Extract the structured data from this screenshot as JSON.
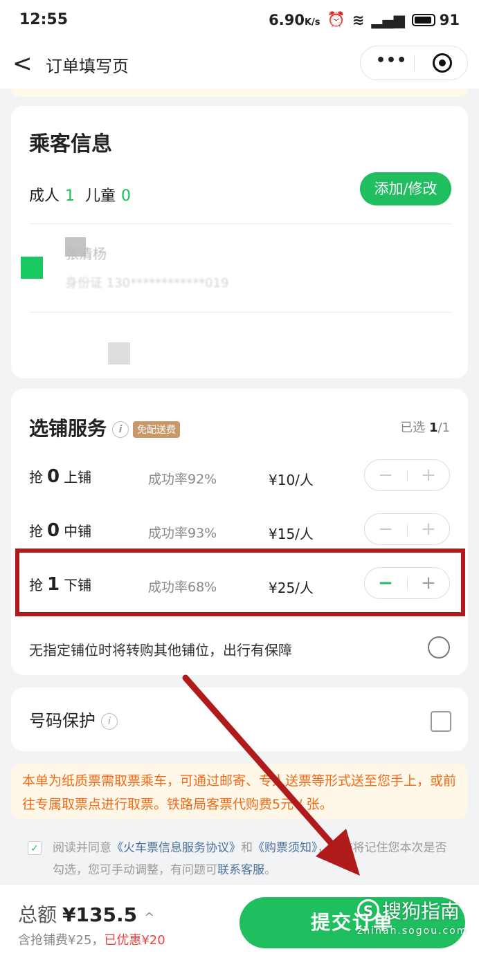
{
  "status_bar": {
    "time": "12:55",
    "speed": "6.90",
    "speed_unit": "K/s",
    "battery": "91"
  },
  "nav": {
    "back_icon": "<",
    "title": "订单填写页",
    "more_label": "•••"
  },
  "passenger": {
    "title": "乘客信息",
    "adult_label": "成人",
    "adult_count": "1",
    "child_label": "儿童",
    "child_count": "0",
    "add_button": "添加/修改",
    "name_blurred": "张清杨",
    "id_blurred": "身份证 130************019"
  },
  "berth": {
    "title": "选铺服务",
    "info_icon": "i",
    "free_badge": "免配送费",
    "selected_prefix": "已选 ",
    "selected_count": "1",
    "selected_total": "/1",
    "rows": [
      {
        "grab": "抢",
        "qty": "0",
        "berth": "上铺",
        "rate": "成功率92%",
        "price": "¥10/人",
        "minus": "−",
        "plus": "+"
      },
      {
        "grab": "抢",
        "qty": "0",
        "berth": "中铺",
        "rate": "成功率93%",
        "price": "¥15/人",
        "minus": "−",
        "plus": "+"
      },
      {
        "grab": "抢",
        "qty": "1",
        "berth": "下铺",
        "rate": "成功率68%",
        "price": "¥25/人",
        "minus": "−",
        "plus": "+"
      }
    ],
    "guarantee_text": "无指定铺位时将转购其他铺位，出行有保障"
  },
  "phone_protection": {
    "title": "号码保护",
    "info_icon": "i"
  },
  "notice": "本单为纸质票需取票乘车，可通过邮寄、专人送票等形式送至您手上，或前往专属取票点进行取票。铁路局客票代购费5元 / 张。",
  "agreement": {
    "check": "✓",
    "prefix": "阅读并同意",
    "link1": "《火车票信息服务协议》",
    "and": "和",
    "link2": "《购票须知》",
    "middle": "，系统将记住您本次是否勾选，您可手动调整，有问题可",
    "link3": "联系客服",
    "suffix": "。"
  },
  "bottom": {
    "total_label": "总额",
    "total_amount": "¥135.5",
    "caret": "^",
    "fee_text": "含抢铺费¥25，",
    "discount_text": "已优惠¥20",
    "submit": "提交订单"
  },
  "watermark": {
    "logo": "S",
    "main": "搜狗指南",
    "sub": "zhinan.sogou.com"
  },
  "colors": {
    "accent_green": "#1fbf60",
    "annotation_red": "#b01a1a",
    "notice_orange": "#f06a1a"
  }
}
